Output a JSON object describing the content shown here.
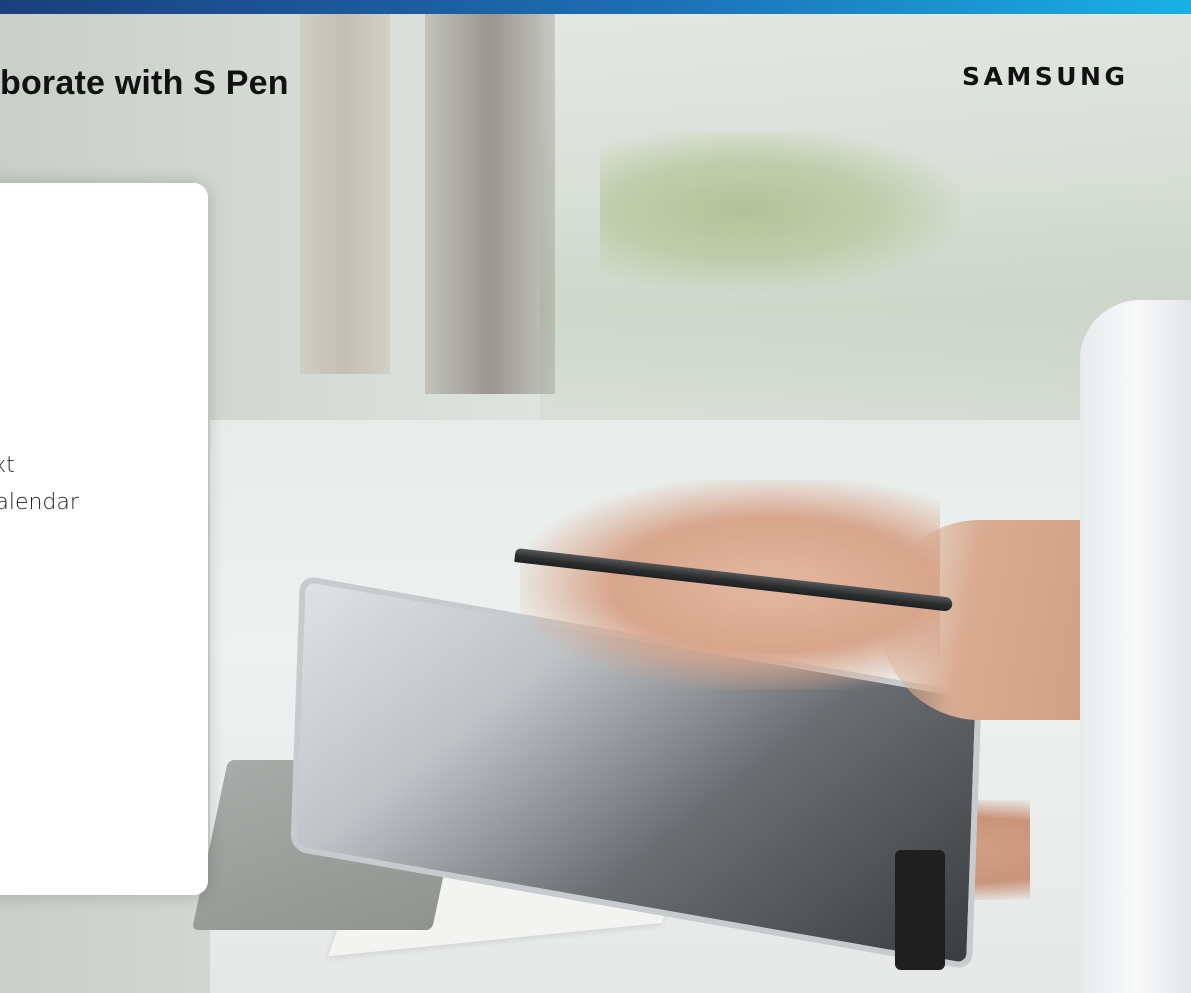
{
  "slide": {
    "title": "borate with S Pen",
    "brand": "SAMSUNG",
    "card": {
      "lines": [
        "ext",
        "Calendar"
      ]
    }
  },
  "colors": {
    "accent_bar_start": "#1a3f7d",
    "accent_bar_end": "#18b0e6",
    "title_text": "#111111",
    "card_background": "#ffffff"
  },
  "icons": {
    "background_photo": "tablet-with-spen-photo"
  }
}
